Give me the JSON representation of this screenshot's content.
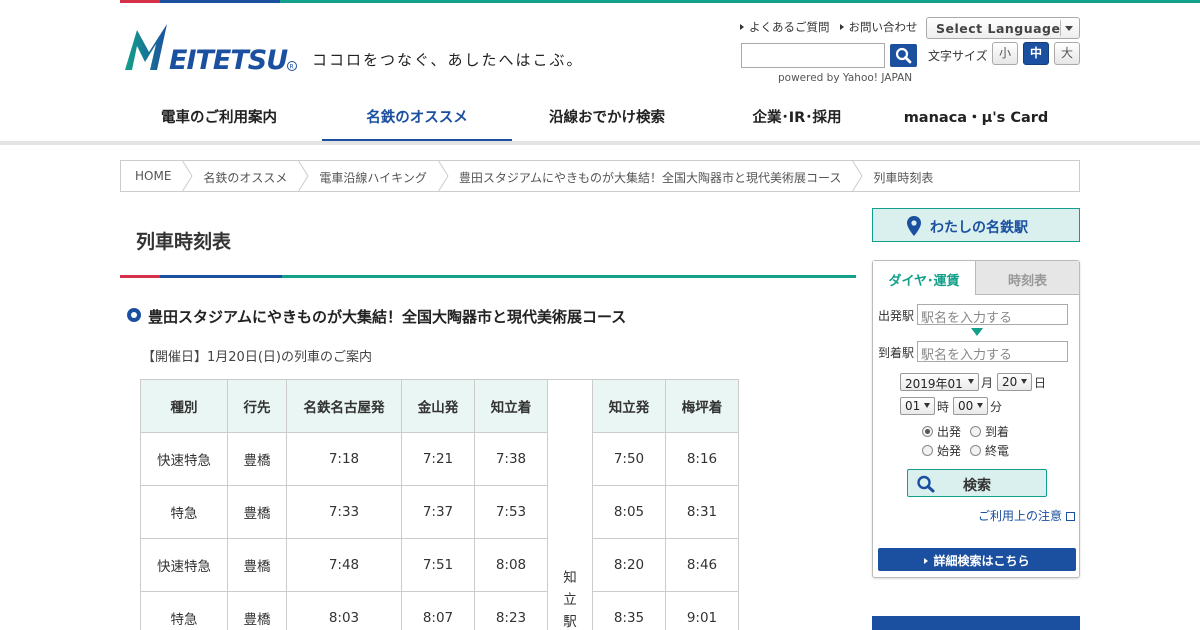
{
  "brand": {
    "logo_text": "MEITETSU",
    "tagline": "ココロをつなぐ、あしたへはこぶ。",
    "colors": {
      "primary": "#1b4fa0",
      "accent_green": "#13a08a",
      "accent_red": "#d7304a"
    }
  },
  "header": {
    "links": [
      "よくあるご質問",
      "お問い合わせ"
    ],
    "language_select": "Select Language",
    "search_powered": "powered by Yahoo! JAPAN",
    "font_size_label": "文字サイズ",
    "font_sizes": [
      "小",
      "中",
      "大"
    ],
    "font_size_active": "中"
  },
  "gnav": [
    {
      "label": "電車のご利用案内",
      "active": false
    },
    {
      "label": "名鉄のオススメ",
      "active": true
    },
    {
      "label": "沿線おでかけ検索",
      "active": false
    },
    {
      "label": "企業･IR･採用",
      "active": false
    },
    {
      "label": "manaca・μ's Card",
      "active": false
    }
  ],
  "breadcrumb": [
    "HOME",
    "名鉄のオススメ",
    "電車沿線ハイキング",
    "豊田スタジアムにやきものが大集結！全国大陶器市と現代美術展コース",
    "列車時刻表"
  ],
  "main": {
    "title": "列車時刻表",
    "section_title": "豊田スタジアムにやきものが大集結！全国大陶器市と現代美術展コース",
    "event_date": "【開催日】1月20日(日)の列車のご案内",
    "table": {
      "headers": [
        "種別",
        "行先",
        "名鉄名古屋発",
        "金山発",
        "知立着",
        "",
        "知立発",
        "梅坪着"
      ],
      "transfer_station": [
        "知",
        "立",
        "駅"
      ],
      "rows": [
        [
          "快速特急",
          "豊橋",
          "7:18",
          "7:21",
          "7:38",
          "7:50",
          "8:16"
        ],
        [
          "特急",
          "豊橋",
          "7:33",
          "7:37",
          "7:53",
          "8:05",
          "8:31"
        ],
        [
          "快速特急",
          "豊橋",
          "7:48",
          "7:51",
          "8:08",
          "8:20",
          "8:46"
        ],
        [
          "特急",
          "豊橋",
          "8:03",
          "8:07",
          "8:23",
          "8:35",
          "9:01"
        ]
      ]
    }
  },
  "sidebar": {
    "my_meitetsu": "わたしの名鉄駅",
    "tabs": [
      {
        "label": "ダイヤ･運賃",
        "active": true
      },
      {
        "label": "時刻表",
        "active": false
      }
    ],
    "depart_label": "出発駅",
    "depart_placeholder": "駅名を入力する",
    "arrive_label": "到着駅",
    "arrive_placeholder": "駅名を入力する",
    "year_month": "2019年01",
    "month_unit": "月",
    "day": "20",
    "day_unit": "日",
    "hour": "01",
    "hour_unit": "時",
    "minute": "00",
    "minute_unit": "分",
    "radios": [
      {
        "label": "出発",
        "checked": true
      },
      {
        "label": "到着",
        "checked": false
      },
      {
        "label": "始発",
        "checked": false
      },
      {
        "label": "終電",
        "checked": false
      }
    ],
    "search_button": "検索",
    "note_link": "ご利用上の注意",
    "detail_button": "詳細検索はこちら"
  }
}
